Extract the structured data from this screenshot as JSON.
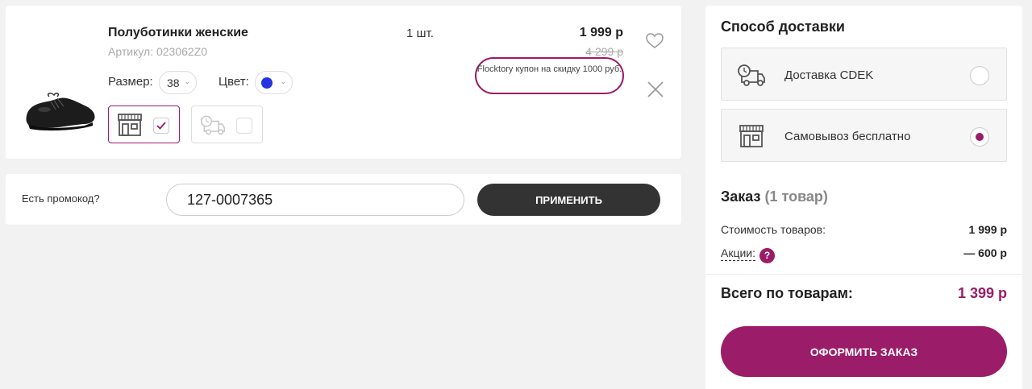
{
  "product": {
    "title": "Полуботинки женские",
    "sku": "Артикул: 023062Z0",
    "size_label": "Размер:",
    "size_value": "38",
    "color_label": "Цвет:",
    "color_value": "#2533e0",
    "quantity": "1 шт.",
    "price": "1 999 р",
    "old_price": "4 299 р",
    "coupon": "Flocktory купон на скидку 1000 руб.",
    "store_delivery_checked": true,
    "courier_delivery_checked": false
  },
  "promo": {
    "label": "Есть промокод?",
    "value": "127-0007365",
    "apply_label": "ПРИМЕНИТЬ"
  },
  "delivery": {
    "title": "Способ доставки",
    "options": [
      {
        "label": "Доставка CDEK",
        "selected": false
      },
      {
        "label": "Самовывоз бесплатно",
        "selected": true
      }
    ]
  },
  "order": {
    "title": "Заказ",
    "count": "(1 товар)",
    "cost_label": "Стоимость товаров:",
    "cost_value": "1 999 р",
    "promo_label": "Акции:",
    "promo_value": "— 600 р",
    "help_glyph": "?",
    "total_label": "Всего по товарам:",
    "total_value": "1 399 р",
    "checkout_label": "ОФОРМИТЬ ЗАКАЗ"
  },
  "colors": {
    "accent": "#9b1c68",
    "dark_button": "#333333",
    "background": "#f2f2f2"
  },
  "icons": [
    "shoe-image",
    "store-icon",
    "delivery-truck-icon",
    "check-icon",
    "heart-icon",
    "close-icon",
    "help-icon"
  ]
}
